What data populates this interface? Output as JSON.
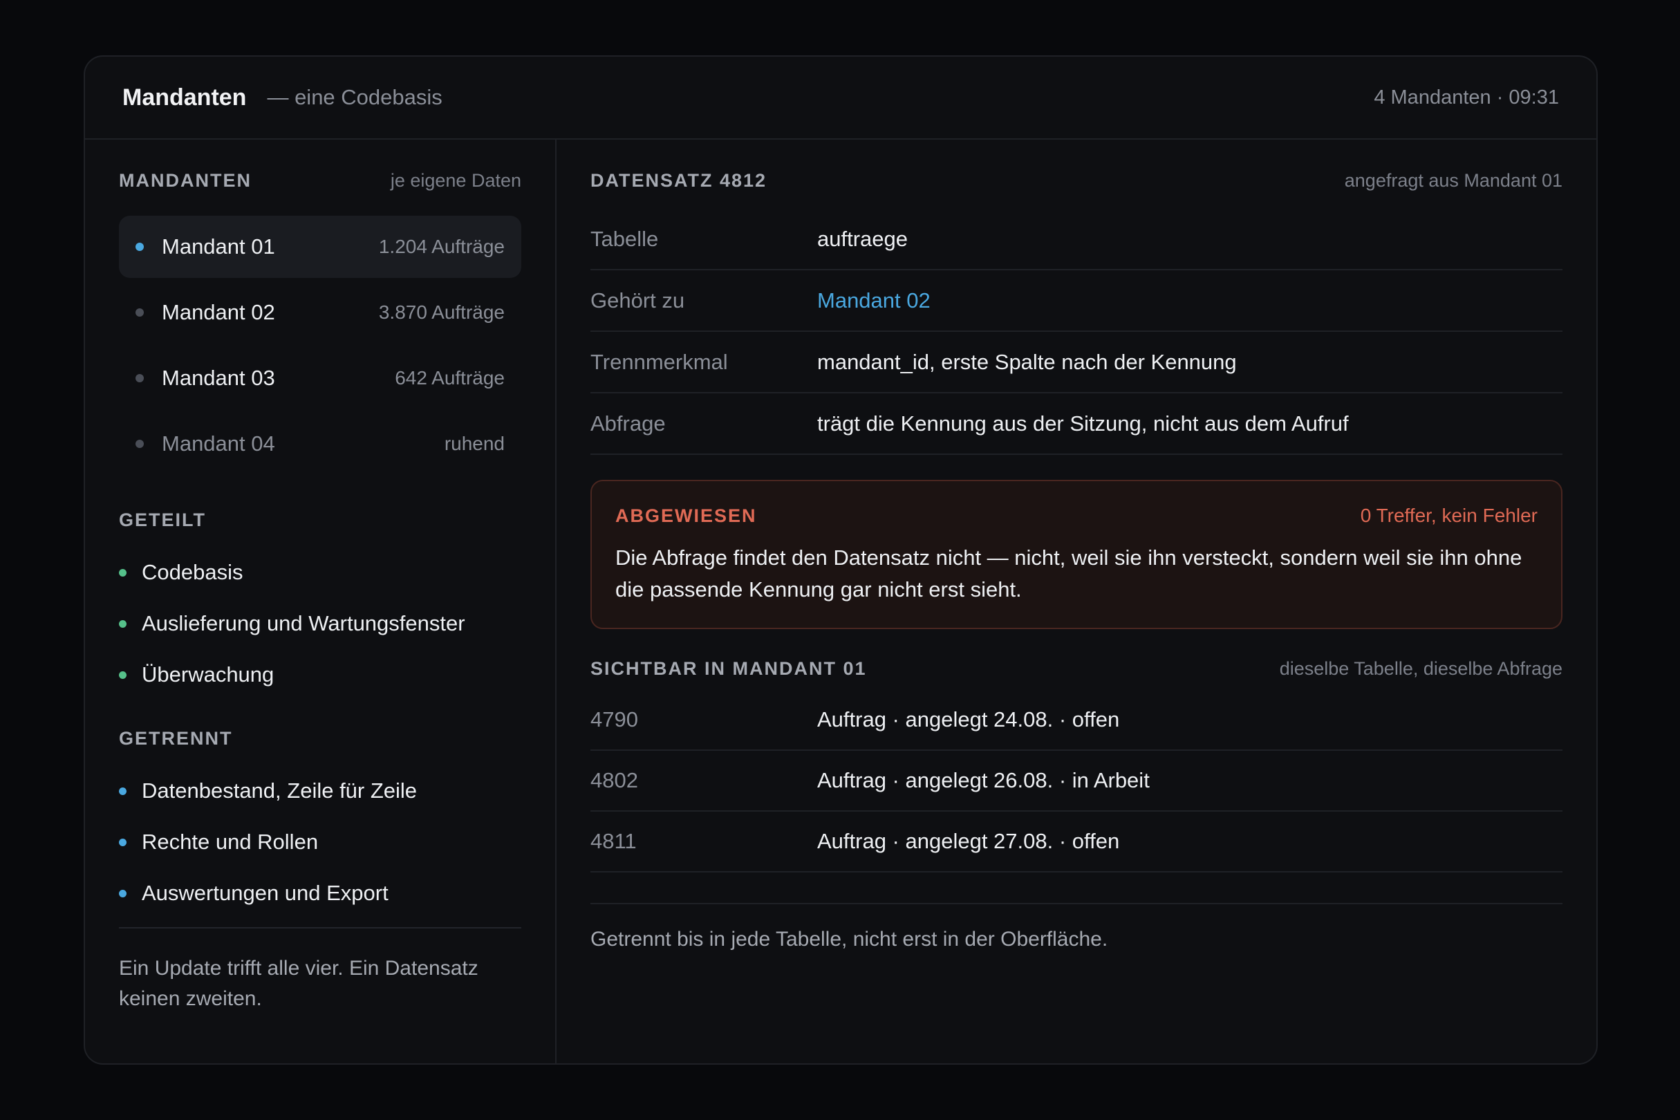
{
  "header": {
    "title": "Mandanten",
    "subtitle": "— eine Codebasis",
    "meta": "4 Mandanten · 09:31"
  },
  "sidebar": {
    "tenants_title": "MANDANTEN",
    "tenants_hint": "je eigene Daten",
    "tenants": [
      {
        "name": "Mandant 01",
        "count": "1.204 Aufträge"
      },
      {
        "name": "Mandant 02",
        "count": "3.870 Aufträge"
      },
      {
        "name": "Mandant 03",
        "count": "642 Aufträge"
      },
      {
        "name": "Mandant 04",
        "count": "ruhend"
      }
    ],
    "shared_title": "GETEILT",
    "shared": [
      "Codebasis",
      "Auslieferung und Wartungsfenster",
      "Überwachung"
    ],
    "separate_title": "GETRENNT",
    "separate": [
      "Datenbestand, Zeile für Zeile",
      "Rechte und Rollen",
      "Auswertungen und Export"
    ],
    "footer": "Ein Update trifft alle vier. Ein Datensatz keinen zweiten."
  },
  "record": {
    "title": "DATENSATZ 4812",
    "hint": "angefragt aus Mandant 01",
    "rows": [
      {
        "key": "Tabelle",
        "value": "auftraege"
      },
      {
        "key": "Gehört zu",
        "value": "Mandant 02"
      },
      {
        "key": "Trennmerkmal",
        "value": "mandant_id, erste Spalte nach der Kennung"
      },
      {
        "key": "Abfrage",
        "value": "trägt die Kennung aus der Sitzung, nicht aus dem Aufruf"
      }
    ]
  },
  "alert": {
    "title": "ABGEWIESEN",
    "meta": "0 Treffer, kein Fehler",
    "text": "Die Abfrage findet den Datensatz nicht — nicht, weil sie ihn versteckt, sondern weil sie ihn ohne die passende Kennung gar nicht erst sieht."
  },
  "visible": {
    "title": "SICHTBAR IN MANDANT 01",
    "hint": "dieselbe Tabelle, dieselbe Abfrage",
    "rows": [
      {
        "id": "4790",
        "value": "Auftrag · angelegt 24.08. · offen"
      },
      {
        "id": "4802",
        "value": "Auftrag · angelegt 26.08. · in Arbeit"
      },
      {
        "id": "4811",
        "value": "Auftrag · angelegt 27.08. · offen"
      }
    ]
  },
  "footer": "Getrennt bis in jede Tabelle, nicht erst in der Oberfläche.",
  "colors": {
    "accent_blue": "#4aa8e0",
    "shared_green": "#55c08a",
    "alert_red": "#e06a55"
  }
}
